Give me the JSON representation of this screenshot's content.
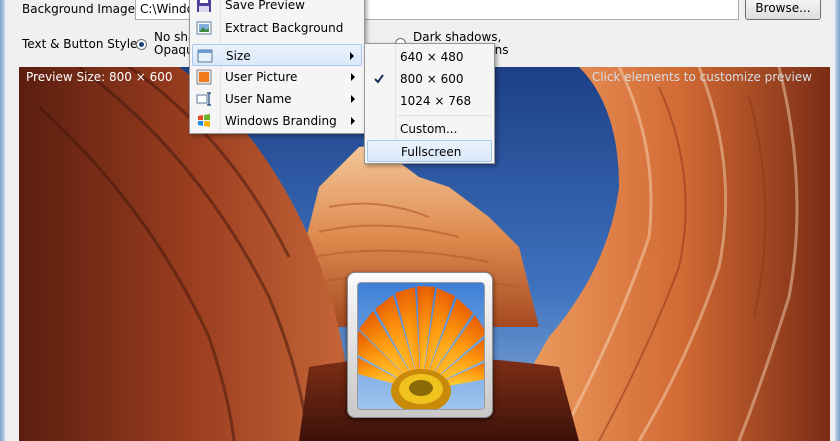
{
  "background_image": {
    "label": "Background Image",
    "path": "C:\\Windo                                           mg7.jpg",
    "browse_label": "Browse..."
  },
  "text_button_style": {
    "label": "Text & Button Style",
    "option_1": "No sha\nOpaqu",
    "option_2": "Dark shadows,\n                 ttons"
  },
  "preview": {
    "size_text": "Preview Size: 800 × 600",
    "hint": "Click elements to customize preview"
  },
  "context_menu": {
    "items": [
      {
        "label": "Save Preview",
        "icon": "floppy-disk-icon"
      },
      {
        "label": "Extract Background",
        "icon": "picture-icon"
      },
      {
        "label": "Size",
        "icon": "window-icon",
        "submenu": true,
        "highlighted": true
      },
      {
        "label": "User Picture",
        "icon": "user-picture-icon",
        "submenu": true
      },
      {
        "label": "User Name",
        "icon": "text-cursor-icon",
        "submenu": true
      },
      {
        "label": "Windows Branding",
        "icon": "windows-logo-icon",
        "submenu": true
      }
    ]
  },
  "size_submenu": {
    "items": [
      {
        "label": "640 × 480"
      },
      {
        "label": "800 × 600",
        "checked": true
      },
      {
        "label": "1024 × 768"
      },
      {
        "label": "Custom..."
      },
      {
        "label": "Fullscreen",
        "highlighted": true
      }
    ]
  },
  "colors": {
    "menu_highlight_border": "#a8c8ed",
    "canyon_orange": "#c0562a",
    "sky_blue": "#2a5aa8"
  }
}
